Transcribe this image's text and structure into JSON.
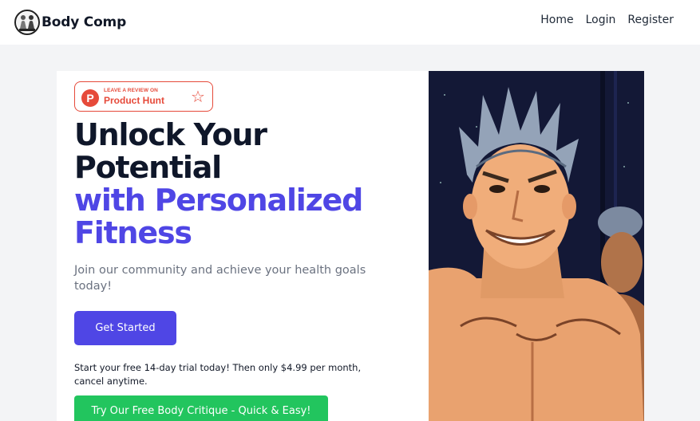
{
  "nav": {
    "brand": "Body Comp",
    "links": [
      "Home",
      "Login",
      "Register"
    ]
  },
  "badge": {
    "small": "LEAVE A REVIEW ON",
    "big": "Product Hunt",
    "logo_letter": "P"
  },
  "hero": {
    "line1": "Unlock Your",
    "line2": "Potential",
    "line3": "with Personalized",
    "line4": "Fitness",
    "subtitle": "Join our community and achieve your health goals today!",
    "cta": "Get Started",
    "trial": "Start your free 14-day trial today! Then only $4.99 per month, cancel anytime.",
    "cta2": "Try Our Free Body Critique - Quick & Easy!"
  },
  "colors": {
    "accent": "#4f46e5",
    "green": "#22c55e",
    "producthunt": "#e64a3a"
  }
}
